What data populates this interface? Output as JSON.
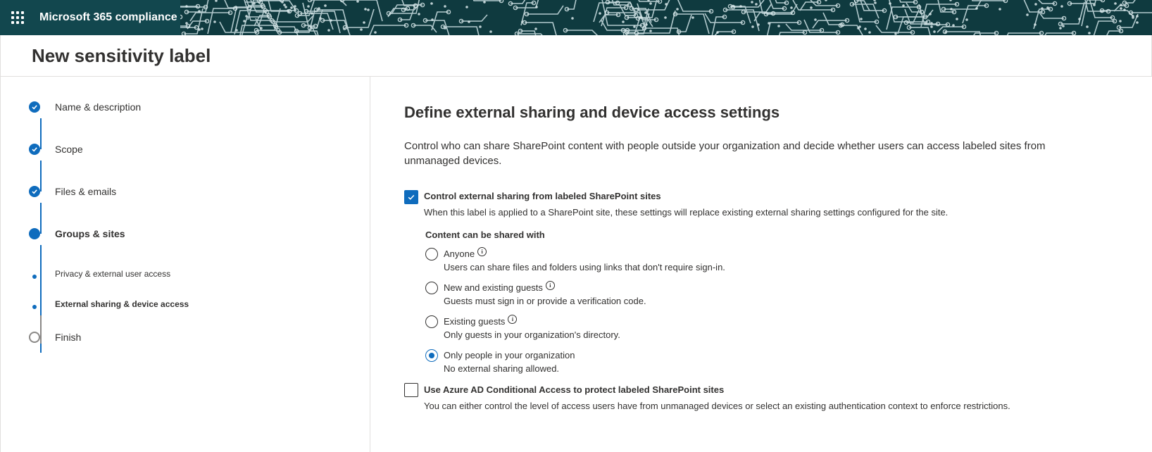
{
  "app": {
    "title": "Microsoft 365 compliance",
    "waffle_icon": "waffle-icon"
  },
  "page": {
    "title": "New sensitivity label"
  },
  "wizard": {
    "steps": [
      {
        "label": "Name & description",
        "state": "complete"
      },
      {
        "label": "Scope",
        "state": "complete"
      },
      {
        "label": "Files & emails",
        "state": "complete"
      },
      {
        "label": "Groups & sites",
        "state": "current"
      },
      {
        "label": "Privacy & external user access",
        "state": "substep"
      },
      {
        "label": "External sharing & device access",
        "state": "substep-current"
      },
      {
        "label": "Finish",
        "state": "pending"
      }
    ]
  },
  "main": {
    "heading": "Define external sharing and device access settings",
    "description": "Control who can share SharePoint content with people outside your organization and decide whether users can access labeled sites from unmanaged devices.",
    "external_sharing": {
      "checked": true,
      "title": "Control external sharing from labeled SharePoint sites",
      "description": "When this label is applied to a SharePoint site, these settings will replace existing external sharing settings configured for the site.",
      "group_label": "Content can be shared with",
      "options": [
        {
          "label": "Anyone",
          "description": "Users can share files and folders using links that don't require sign-in.",
          "info": true,
          "selected": false
        },
        {
          "label": "New and existing guests",
          "description": "Guests must sign in or provide a verification code.",
          "info": true,
          "selected": false
        },
        {
          "label": "Existing guests",
          "description": "Only guests in your organization's directory.",
          "info": true,
          "selected": false
        },
        {
          "label": "Only people in your organization",
          "description": "No external sharing allowed.",
          "info": false,
          "selected": true
        }
      ]
    },
    "conditional_access": {
      "checked": false,
      "title": "Use Azure AD Conditional Access to protect labeled SharePoint sites",
      "description": "You can either control the level of access users have from unmanaged devices or select an existing authentication context to enforce restrictions."
    }
  },
  "colors": {
    "accent": "#0f6cbd",
    "header": "#0f3a3f",
    "text": "#323130"
  }
}
